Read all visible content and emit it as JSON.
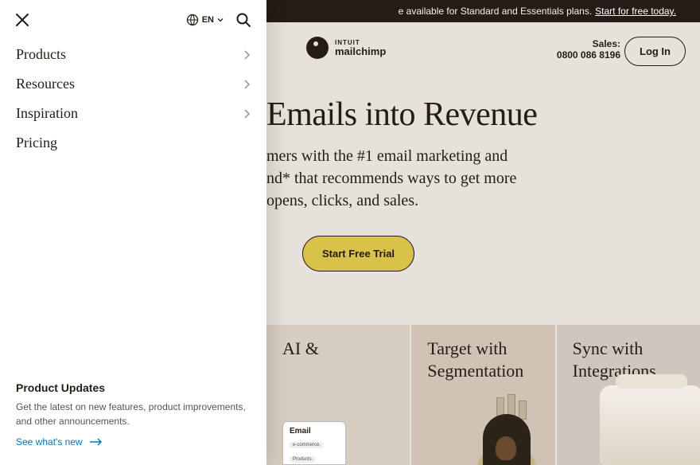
{
  "promo": {
    "text": "e available for Standard and Essentials plans.",
    "link": "Start for free today."
  },
  "brand": {
    "parent": "INTUIT",
    "name": "mailchimp"
  },
  "sales": {
    "label": "Sales:",
    "phone": "0800 086 8196"
  },
  "login_label": "Log In",
  "hero": {
    "title": "Emails into Revenue",
    "sub_line1": "mers with the #1 email marketing and",
    "sub_line2": "nd* that recommends ways to get more",
    "sub_line3": "opens, clicks, and sales.",
    "cta": "Start Free Trial"
  },
  "cards": [
    {
      "title_line1": "AI &",
      "email_label": "Email",
      "email_chip1": "e-commerce.",
      "email_chip2": "Products."
    },
    {
      "title_line1": "Target with",
      "title_line2": "Segmentation"
    },
    {
      "title_line1": "Sync with",
      "title_line2": "Integrations"
    }
  ],
  "drawer": {
    "lang_code": "EN",
    "nav": [
      {
        "label": "Products",
        "has_children": true
      },
      {
        "label": "Resources",
        "has_children": true
      },
      {
        "label": "Inspiration",
        "has_children": true
      },
      {
        "label": "Pricing",
        "has_children": false
      }
    ],
    "footer": {
      "heading": "Product Updates",
      "body": "Get the latest on new features, product improvements, and other announcements.",
      "link": "See what's new"
    }
  }
}
